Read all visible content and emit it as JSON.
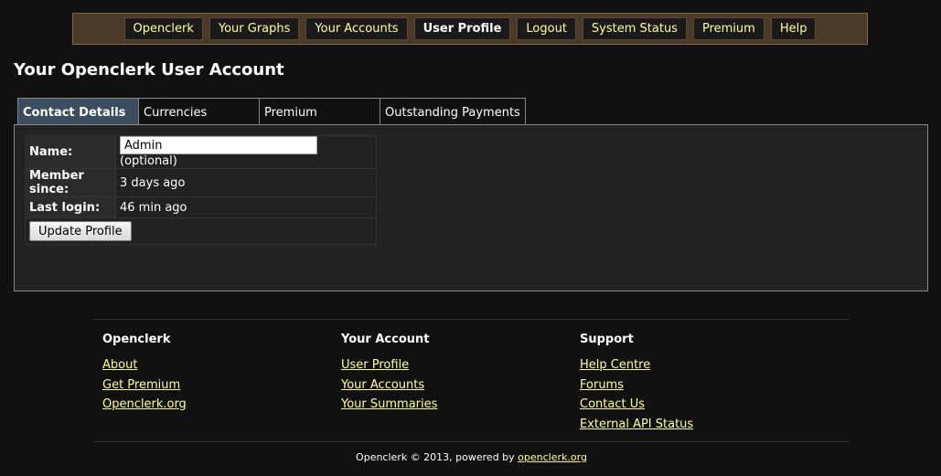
{
  "nav": {
    "items": [
      {
        "label": "Openclerk",
        "active": false
      },
      {
        "label": "Your Graphs",
        "active": false
      },
      {
        "label": "Your Accounts",
        "active": false
      },
      {
        "label": "User Profile",
        "active": true
      },
      {
        "label": "Logout",
        "active": false
      },
      {
        "label": "System Status",
        "active": false
      },
      {
        "label": "Premium",
        "active": false
      },
      {
        "label": "Help",
        "active": false
      }
    ]
  },
  "page": {
    "title": "Your Openclerk User Account"
  },
  "tabs": [
    {
      "label": "Contact Details",
      "active": true
    },
    {
      "label": "Currencies",
      "active": false
    },
    {
      "label": "Premium",
      "active": false
    },
    {
      "label": "Outstanding Payments",
      "active": false
    }
  ],
  "profile": {
    "name_label": "Name:",
    "name_value": "Admin",
    "name_note": "(optional)",
    "member_label": "Member since:",
    "member_value": "3 days ago",
    "login_label": "Last login:",
    "login_value": "46 min ago",
    "update_button": "Update Profile"
  },
  "footer": {
    "columns": [
      {
        "heading": "Openclerk",
        "links": [
          "About",
          "Get Premium",
          "Openclerk.org"
        ]
      },
      {
        "heading": "Your Account",
        "links": [
          "User Profile",
          "Your Accounts",
          "Your Summaries"
        ]
      },
      {
        "heading": "Support",
        "links": [
          "Help Centre",
          "Forums",
          "Contact Us",
          "External API Status"
        ]
      }
    ],
    "copyright": "Openclerk © 2013, powered by",
    "powered_link": "openclerk.org"
  },
  "colors": {
    "background": "#111111",
    "nav_bar": "#4a3a27",
    "link": "#ffff99",
    "active_tab": "#3b4d5e",
    "panel": "#222222"
  }
}
